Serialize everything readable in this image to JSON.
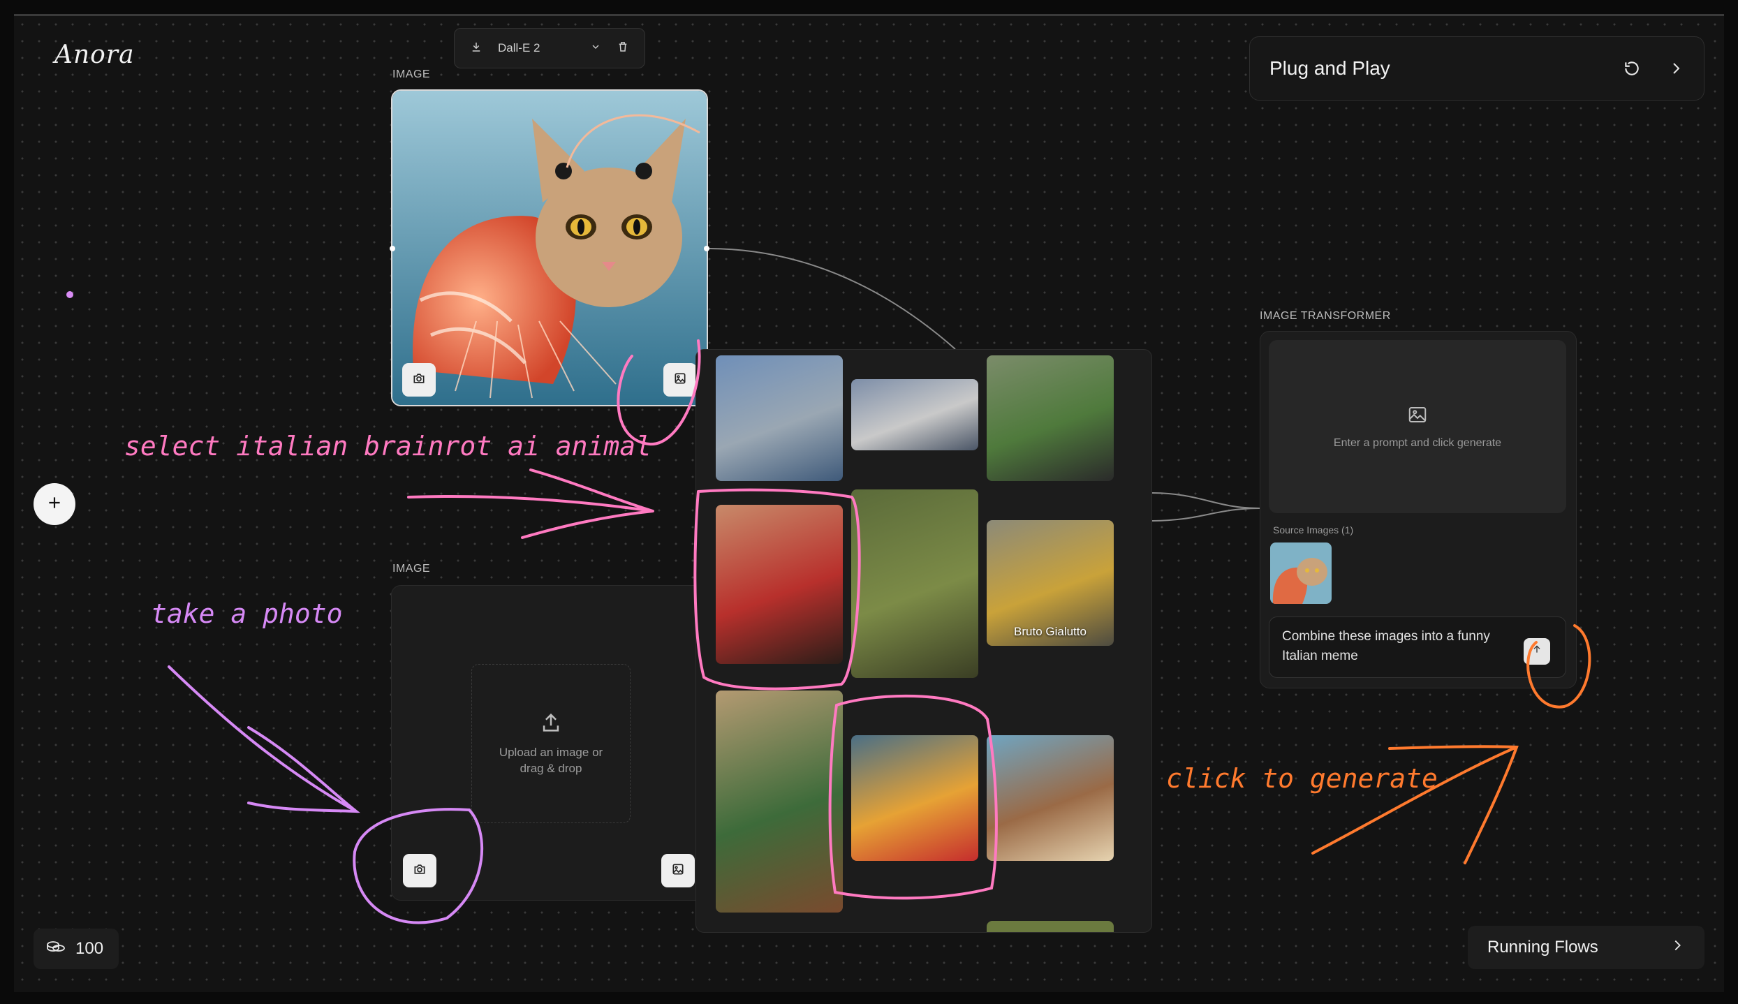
{
  "app": {
    "logo": "Anora"
  },
  "toolbar": {
    "model": "Dall-E 2",
    "download_icon": "download-icon",
    "chevron_icon": "chevron-down-icon",
    "delete_icon": "trash-icon"
  },
  "image_node_1": {
    "label": "IMAGE",
    "camera_icon": "camera-icon",
    "gallery_icon": "image-icon"
  },
  "image_node_2": {
    "label": "IMAGE",
    "upload_text": "Upload an image or drag & drop",
    "upload_icon": "upload-icon",
    "camera_icon": "camera-icon",
    "gallery_icon": "image-icon"
  },
  "gallery": {
    "items": [
      {
        "caption": "",
        "colors": [
          "#6f8fb8",
          "#9aa7b3",
          "#3f5a7a"
        ]
      },
      {
        "caption": "",
        "colors": [
          "#7d8ea8",
          "#c9c9c9",
          "#4a5566"
        ]
      },
      {
        "caption": "",
        "colors": [
          "#7b8c6a",
          "#4f7a3c",
          "#2a2a2a"
        ]
      },
      {
        "caption": "",
        "colors": [
          "#c88a6a",
          "#b8302c",
          "#2b1d18"
        ]
      },
      {
        "caption": "",
        "colors": [
          "#5b6b3a",
          "#7c8b47",
          "#3a3e24"
        ]
      },
      {
        "caption": "Bruto Gialutto",
        "colors": [
          "#8c8a78",
          "#c9a23a",
          "#4d4b40"
        ]
      },
      {
        "caption": "",
        "colors": [
          "#b49a72",
          "#3d6b3a",
          "#7a4a2e"
        ]
      },
      {
        "caption": "",
        "colors": [
          "#4a6f86",
          "#e6a235",
          "#c52d2d"
        ]
      },
      {
        "caption": "",
        "colors": [
          "#6fa5c2",
          "#9a6a46",
          "#e6d3b0"
        ]
      }
    ]
  },
  "plug_and_play": {
    "title": "Plug and Play",
    "refresh_icon": "refresh-icon",
    "next_icon": "chevron-right-icon"
  },
  "transformer": {
    "label": "IMAGE TRANSFORMER",
    "placeholder": "Enter a prompt and click generate",
    "source_label": "Source Images (1)",
    "prompt": "Combine these images into a funny Italian meme",
    "send_icon": "arrow-up-icon"
  },
  "credits": {
    "value": "100",
    "icon": "coins-icon"
  },
  "running_flows": {
    "label": "Running Flows",
    "icon": "chevron-right-icon"
  },
  "add_icon": "plus-icon",
  "annotations": {
    "select": "select italian brainrot ai animal",
    "photo": "take a photo",
    "generate": "click to generate",
    "pink": "#ff7ac1",
    "violet": "#d689f5",
    "orange": "#ff7a2e"
  }
}
